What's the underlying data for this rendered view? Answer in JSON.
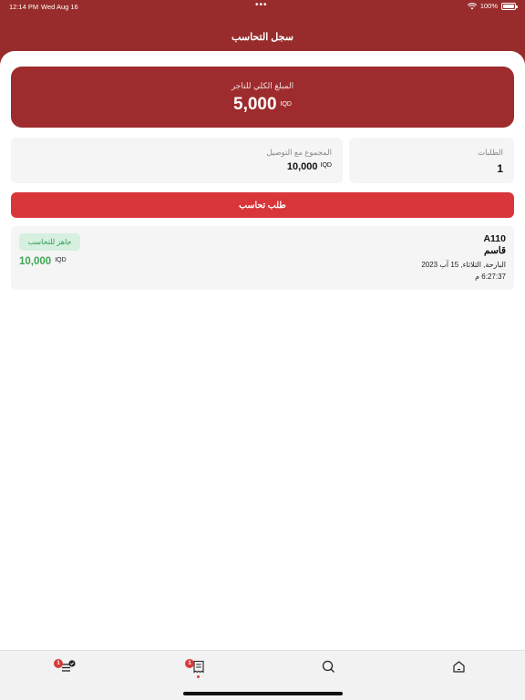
{
  "status_bar": {
    "time": "12:14 PM",
    "date": "Wed Aug 16",
    "dots": "•••",
    "battery": "100%"
  },
  "header": {
    "title": "سجل التحاسب"
  },
  "total_card": {
    "label": "المبلغ الكلي للتاجر",
    "value": "5,000",
    "currency": "IQD"
  },
  "stats": {
    "orders_label": "الطلبات",
    "orders_value": "1",
    "delivery_label": "المجموع مع التوصيل",
    "delivery_value": "10,000",
    "delivery_currency": "IQD"
  },
  "request_button": {
    "label": "طلب تحاسب"
  },
  "order": {
    "id": "A110",
    "name": "قاسم",
    "date": "البارحة, الثلاثاء, 15 آب 2023",
    "time": "6:27:37 م",
    "status": "جاهز للتحاسب",
    "amount": "10,000",
    "currency": "IQD"
  },
  "tabbar": {
    "orders_badge": "1",
    "cart_badge": "1"
  },
  "colors": {
    "primary": "#982c2c",
    "button": "#d8363b",
    "success": "#3ea655",
    "success_bg": "#d6efdf"
  }
}
